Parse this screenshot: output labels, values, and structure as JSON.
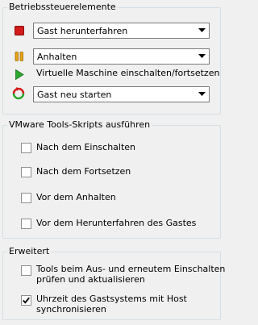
{
  "controls": {
    "title": "Betriebssteuerelemente",
    "shutdown_select": "Gast herunterfahren",
    "pause_select": "Anhalten",
    "resume_label": "Virtuelle Maschine einschalten/fortsetzen",
    "restart_select": "Gast neu starten"
  },
  "scripts": {
    "title": "VMware Tools-Skripts ausführen",
    "items": [
      {
        "label": "Nach dem Einschalten",
        "checked": false
      },
      {
        "label": "Nach dem Fortsetzen",
        "checked": false
      },
      {
        "label": "Vor dem Anhalten",
        "checked": false
      },
      {
        "label": "Vor dem Herunterfahren des Gastes",
        "checked": false
      }
    ]
  },
  "advanced": {
    "title": "Erweitert",
    "items": [
      {
        "line1": "Tools beim Aus- und erneutem Einschalten",
        "line2": "prüfen und aktualisieren",
        "checked": false
      },
      {
        "line1": "Uhrzeit des Gastsystems mit Host",
        "line2": "synchronisieren",
        "checked": true
      }
    ]
  },
  "colors": {
    "stop": "#d31a1a",
    "pause": "#e8a317",
    "play": "#2ea82e",
    "restart_green": "#2ea82e",
    "restart_red": "#d31a1a",
    "group_border": "#d5dfe5"
  },
  "icons": [
    "stop-icon",
    "pause-icon",
    "play-icon",
    "restart-icon",
    "chevron-down-icon",
    "checkmark-icon"
  ]
}
